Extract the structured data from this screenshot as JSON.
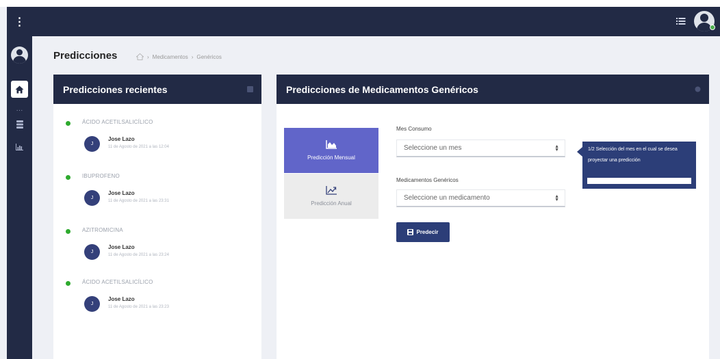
{
  "header": {
    "title": "Predicciones",
    "breadcrumb": [
      "Medicamentos",
      "Genéricos"
    ]
  },
  "recent": {
    "title": "Predicciones recientes",
    "entries": [
      {
        "drug": "ÁCIDO ACETILSALICÍLICO",
        "avatar": "J",
        "user": "Jose Lazo",
        "date": "11 de Agosto de 2021 a las 12:04"
      },
      {
        "drug": "IBUPROFENO",
        "avatar": "J",
        "user": "Jose Lazo",
        "date": "11 de Agosto de 2021 a las 23:31"
      },
      {
        "drug": "AZITROMICINA",
        "avatar": "J",
        "user": "Jose Lazo",
        "date": "11 de Agosto de 2021 a las 23:24"
      },
      {
        "drug": "ÁCIDO ACETILSALICÍLICO",
        "avatar": "J",
        "user": "Jose Lazo",
        "date": "11 de Agosto de 2021 a las 23:23"
      }
    ]
  },
  "main": {
    "title": "Predicciones de Medicamentos Genéricos",
    "tabs": {
      "monthly": "Predicción Mensual",
      "annual": "Predicción Anual"
    },
    "month_label": "Mes Consumo",
    "month_placeholder": "Seleccione un mes",
    "drug_label": "Medicamentos Genéricos",
    "drug_placeholder": "Seleccione un medicamento",
    "predict_button": "Predecir"
  },
  "tooltip": {
    "text": "1/2 Selección del mes en el cual se desea proyectar una predicción"
  },
  "colors": {
    "navy": "#222a45",
    "accent": "#6165c9",
    "button": "#2c3e78",
    "timeline_dot": "#2eaa2e"
  }
}
